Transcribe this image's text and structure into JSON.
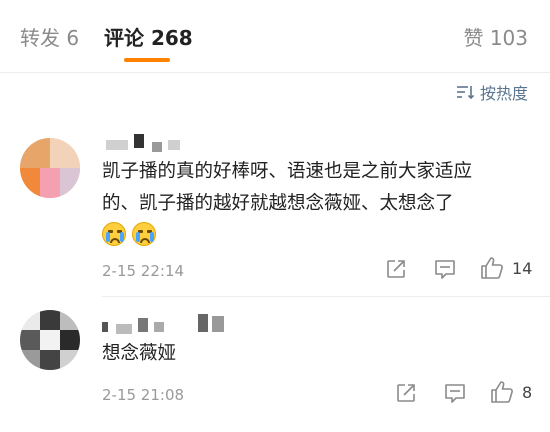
{
  "tabs": {
    "repost": "转发 6",
    "comments": "评论 268",
    "likes": "赞 103"
  },
  "sort": {
    "label": "按热度",
    "icon": "sort-icon"
  },
  "comments": [
    {
      "text_line1": "凯子播的真的好棒呀、语速也是之前大家适应",
      "text_line2": "的、凯子播的越好就越想念薇娅、太想念了",
      "emojis": [
        "crying-face-icon",
        "crying-face-icon"
      ],
      "time": "2-15 22:14",
      "likes": "14"
    },
    {
      "text_line1": "想念薇娅",
      "time": "2-15 21:08",
      "likes": "8"
    }
  ],
  "colors": {
    "accent": "#ff8200",
    "link": "#5b7590",
    "muted": "#9a9a9a"
  }
}
